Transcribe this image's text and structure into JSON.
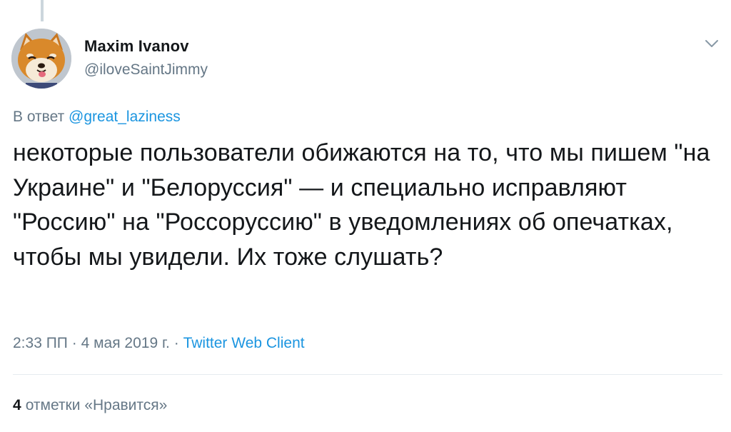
{
  "author": {
    "name": "Maxim Ivanov",
    "handle": "@iloveSaintJimmy",
    "avatar_icon": "shiba-dog-avatar"
  },
  "menu": {
    "icon": "chevron-down-icon"
  },
  "reply": {
    "prefix": "В ответ",
    "mention": "@great_laziness"
  },
  "tweet": {
    "text": "некоторые пользователи обижаются на то, что мы пишем \"на Украине\" и \"Белоруссия\" — и специально исправляют \"Россию\" на \"Россоруссию\" в уведомлениях об опечатках, чтобы мы увидели. Их тоже слушать?"
  },
  "meta": {
    "time": "2:33 ПП",
    "separator": " · ",
    "date": "4 мая 2019 г.",
    "source": "Twitter Web Client"
  },
  "likes": {
    "count": "4",
    "label": "отметки «Нравится»"
  },
  "colors": {
    "link": "#1b95e0",
    "secondary_text": "#657786",
    "primary_text": "#14171a",
    "divider": "#e6ecf0"
  }
}
